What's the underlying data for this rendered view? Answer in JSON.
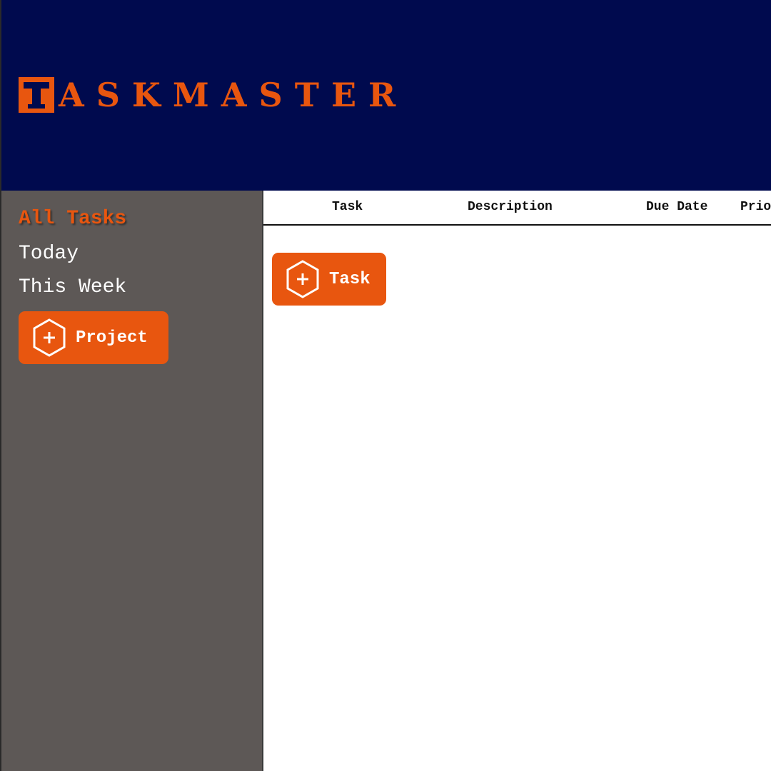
{
  "app": {
    "logo_text": "ASKMASTER",
    "logo_letter": "T"
  },
  "sidebar": {
    "items": [
      {
        "label": "All Tasks",
        "active": true
      },
      {
        "label": "Today",
        "active": false
      },
      {
        "label": "This Week",
        "active": false
      }
    ],
    "add_project_label": "Project"
  },
  "table": {
    "columns": [
      "Task",
      "Description",
      "Due Date",
      "Priority"
    ]
  },
  "main": {
    "add_task_label": "Task"
  },
  "colors": {
    "header_bg": "#000a4e",
    "accent": "#e8560f",
    "sidebar_bg": "#5d5856"
  }
}
